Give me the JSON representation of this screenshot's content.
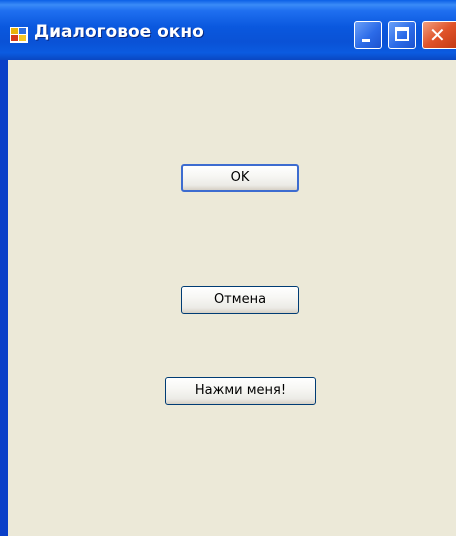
{
  "window": {
    "title": "Диалоговое окно",
    "icon": "app-window-icon",
    "controls": {
      "minimize_icon": "minimize-icon",
      "maximize_icon": "maximize-icon",
      "close_icon": "close-icon",
      "close_glyph": "✕"
    },
    "colors": {
      "titlebar": "#0a58de",
      "client_background": "#ece9d8",
      "close_button": "#e0532a"
    }
  },
  "buttons": {
    "ok_label": "OK",
    "cancel_label": "Отмена",
    "press_me_label": "Нажми меня!"
  }
}
